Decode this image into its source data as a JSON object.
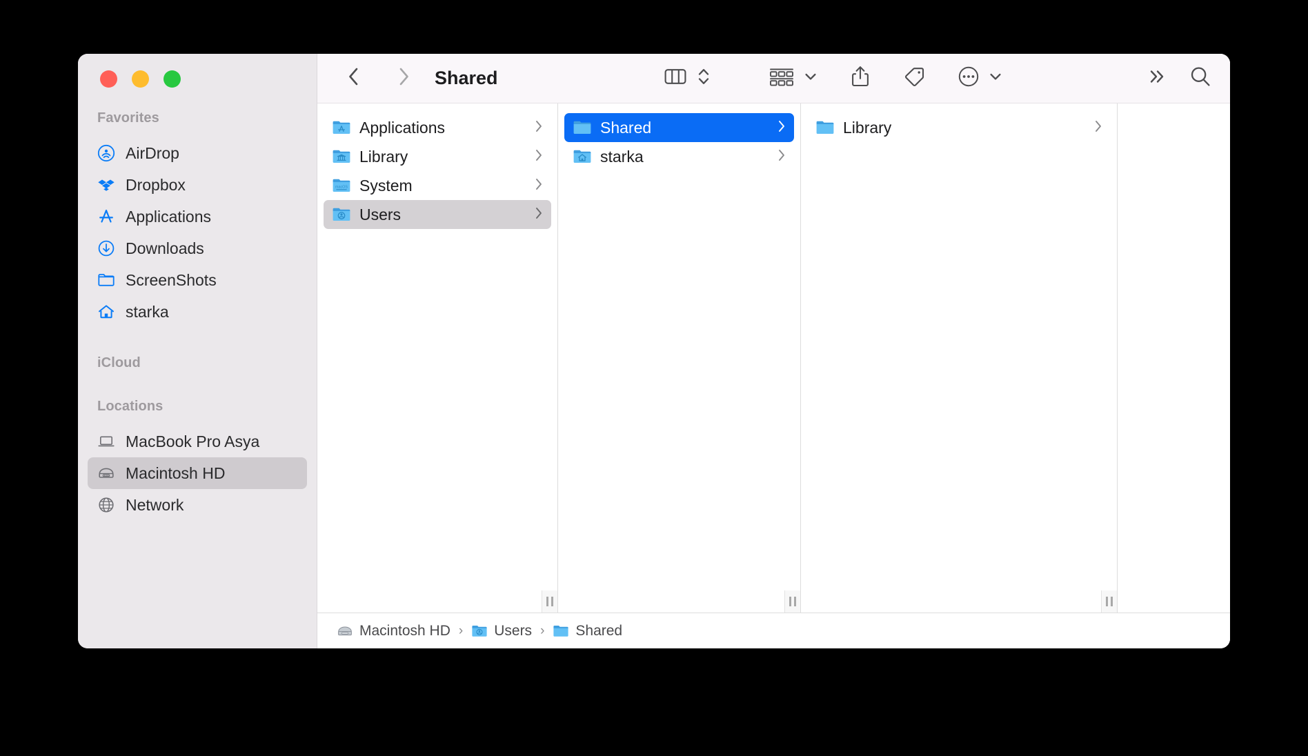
{
  "window": {
    "title": "Shared",
    "traffic_lights": [
      {
        "name": "close",
        "color": "#ff5f57"
      },
      {
        "name": "minimize",
        "color": "#febc2e"
      },
      {
        "name": "maximize",
        "color": "#28c840"
      }
    ]
  },
  "toolbar": {
    "back_icon": "chevron-left-icon",
    "forward_icon": "chevron-right-icon",
    "title": "Shared",
    "view_icon": "column-view-icon",
    "view_stepper_icon": "chevron-up-down-icon",
    "group_icon": "group-by-icon",
    "group_chevron_icon": "chevron-down-icon",
    "share_icon": "share-icon",
    "tag_icon": "tag-icon",
    "more_icon": "ellipsis-circle-icon",
    "more_chevron_icon": "chevron-down-icon",
    "overflow_icon": "double-chevron-right-icon",
    "search_icon": "search-icon"
  },
  "sidebar": {
    "sections": [
      {
        "title": "Favorites",
        "items": [
          {
            "label": "AirDrop",
            "icon": "airdrop-icon",
            "selected": false
          },
          {
            "label": "Dropbox",
            "icon": "dropbox-icon",
            "selected": false
          },
          {
            "label": "Applications",
            "icon": "applications-icon",
            "selected": false
          },
          {
            "label": "Downloads",
            "icon": "downloads-icon",
            "selected": false
          },
          {
            "label": "ScreenShots",
            "icon": "folder-icon",
            "selected": false
          },
          {
            "label": "starka",
            "icon": "home-icon",
            "selected": false
          }
        ]
      },
      {
        "title": "iCloud",
        "items": []
      },
      {
        "title": "Locations",
        "items": [
          {
            "label": "MacBook Pro Asya",
            "icon": "laptop-icon",
            "selected": false
          },
          {
            "label": "Macintosh HD",
            "icon": "harddisk-icon",
            "selected": true
          },
          {
            "label": "Network",
            "icon": "globe-icon",
            "selected": false
          }
        ]
      }
    ]
  },
  "columns": [
    {
      "name": "column-1",
      "rows": [
        {
          "label": "Applications",
          "icon": "folder-applications-icon",
          "has_chevron": true,
          "selection": "none"
        },
        {
          "label": "Library",
          "icon": "folder-library-icon",
          "has_chevron": true,
          "selection": "none"
        },
        {
          "label": "System",
          "icon": "folder-system-icon",
          "has_chevron": true,
          "selection": "none"
        },
        {
          "label": "Users",
          "icon": "folder-users-icon",
          "has_chevron": true,
          "selection": "gray"
        }
      ]
    },
    {
      "name": "column-2",
      "rows": [
        {
          "label": "Shared",
          "icon": "folder-icon",
          "has_chevron": true,
          "selection": "blue"
        },
        {
          "label": "starka",
          "icon": "folder-home-icon",
          "has_chevron": true,
          "selection": "none"
        }
      ]
    },
    {
      "name": "column-3",
      "rows": [
        {
          "label": "Library",
          "icon": "folder-icon",
          "has_chevron": true,
          "selection": "none"
        }
      ]
    },
    {
      "name": "column-4",
      "rows": []
    }
  ],
  "pathbar": {
    "crumbs": [
      {
        "label": "Macintosh HD",
        "icon": "harddisk-icon"
      },
      {
        "label": "Users",
        "icon": "folder-users-icon"
      },
      {
        "label": "Shared",
        "icon": "folder-icon"
      }
    ],
    "separator": "›"
  },
  "colors": {
    "selection_blue": "#0a6cf5",
    "sidebar_bg": "#ebe8eb",
    "toolbar_bg": "#faf7fa",
    "accent_icon_blue": "#0a7cf7"
  }
}
